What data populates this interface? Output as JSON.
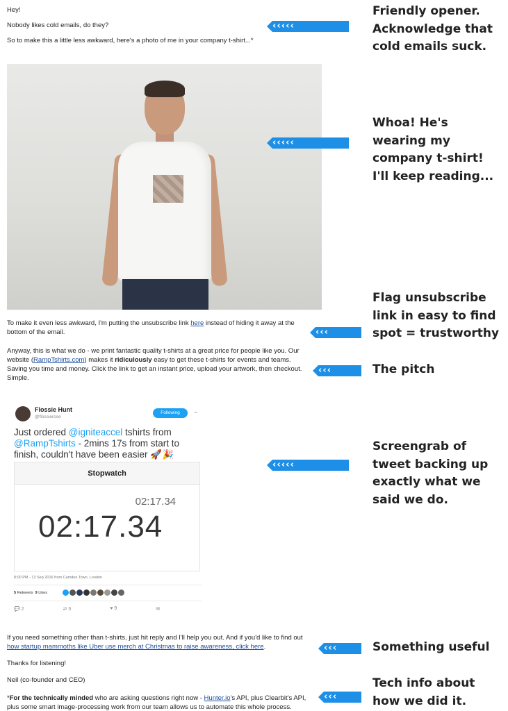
{
  "email": {
    "greeting": "Hey!",
    "line2": "Nobody likes cold emails, do they?",
    "line3": "So to make this a little less awkward, here's a photo of me in your company t-shirt...*",
    "unsub_pre": "To make it even less awkward, I'm putting the unsubscribe link",
    "unsub_link": "here",
    "unsub_post": "instead of hiding it away at the",
    "unsub_line2": "bottom of the email.",
    "pitch_line1": "Anyway, this is what we do - we print fantastic quality t-shirts at a great price for people like you. Our",
    "pitch_line2_pre": "website (",
    "pitch_link": "RampTshirts.com",
    "pitch_line2_mid": ") makes it",
    "pitch_bold": "ridiculously",
    "pitch_line2_post": "easy to get these t-shirts for events and teams.",
    "pitch_line3": "Saving you time and money. Click the link to get an instant price, upload your artwork, then checkout.",
    "pitch_line4": "Simple.",
    "useful_line1": "If you need something other than t-shirts, just hit reply and I'll help you out. And if you'd like to find out",
    "useful_link": "how startup mammoths like Uber use merch at Christmas to raise awareness, click here",
    "useful_end": ".",
    "thanks": "Thanks for listening!",
    "signature": "Neil (co-founder and CEO)",
    "tech_star": "*",
    "tech_bold": "For the technically minded",
    "tech_line1_mid": "who are asking questions right now -",
    "tech_link": "Hunter.io",
    "tech_line1_post": "'s API, plus Clearbit's API,",
    "tech_line2": "plus some smart image-processing work from our team allows us to automate this whole process."
  },
  "notes": {
    "n1_l1": "Friendly opener.",
    "n1_l2": "Acknowledge that",
    "n1_l3": "cold emails suck.",
    "n2_l1": "Whoa! He's",
    "n2_l2": "wearing my",
    "n2_l3": "company t-shirt!",
    "n2_l4": "I'll keep reading...",
    "n3_l1": "Flag unsubscribe",
    "n3_l2": "link in easy to find",
    "n3_l3": "spot = trustworthy",
    "n4_l1": "The pitch",
    "n5_l1": "Screengrab of",
    "n5_l2": "tweet backing up",
    "n5_l3": "exactly what we",
    "n5_l4": "said we do.",
    "n6_l1": "Something useful",
    "n7_l1": "Tech info about",
    "n7_l2": "how we did it."
  },
  "tweet": {
    "name": "Flossie Hunt",
    "handle": "@flossierose",
    "follow": "Following",
    "caret": "⌄",
    "text_pre": "Just ordered ",
    "mention1": "@igniteaccel",
    "text_mid": " tshirts from",
    "mention2": "@RampTshirts",
    "text_post": " - 2mins 17s from start to finish, couldn't have been easier 🚀🎉",
    "stopwatch_title": "Stopwatch",
    "stopwatch_small": "02:17.34",
    "stopwatch_big": "02:17.34",
    "meta": "8:00 PM - 13 Sep 2016 from Camden Town, London",
    "retweets_count": "5",
    "retweets_label": "Retweets",
    "likes_count": "9",
    "likes_label": "Likes",
    "reply_count": "2",
    "retweet_action_count": "5",
    "like_action_count": "9"
  },
  "colors": {
    "arrow": "#1e8fe6",
    "link": "#1a4fa0",
    "twitter": "#1da1f2"
  }
}
